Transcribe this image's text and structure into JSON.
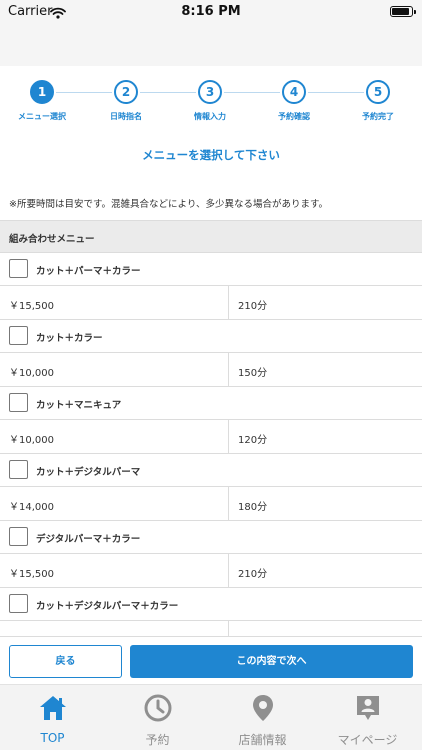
{
  "status_bar": {
    "carrier": "Carrier",
    "time": "8:16 PM"
  },
  "steps": [
    {
      "number": "1",
      "label": "メニュー選択",
      "active": true
    },
    {
      "number": "2",
      "label": "日時指名",
      "active": false
    },
    {
      "number": "3",
      "label": "情報入力",
      "active": false
    },
    {
      "number": "4",
      "label": "予約確認",
      "active": false
    },
    {
      "number": "5",
      "label": "予約完了",
      "active": false
    }
  ],
  "heading": "メニューを選択して下さい",
  "notice": "※所要時間は目安です。混雑具合などにより、多少異なる場合があります。",
  "section": {
    "title": "組み合わせメニュー"
  },
  "menu_items": [
    {
      "name": "カット＋パーマ＋カラー",
      "price": "￥15,500",
      "duration": "210分"
    },
    {
      "name": "カット＋カラー",
      "price": "￥10,000",
      "duration": "150分"
    },
    {
      "name": "カット＋マニキュア",
      "price": "￥10,000",
      "duration": "120分"
    },
    {
      "name": "カット＋デジタルパーマ",
      "price": "￥14,000",
      "duration": "180分"
    },
    {
      "name": "デジタルパーマ＋カラー",
      "price": "￥15,500",
      "duration": "210分"
    },
    {
      "name": "カット＋デジタルパーマ＋カラー",
      "price": "",
      "duration": ""
    }
  ],
  "buttons": {
    "back": "戻る",
    "next": "この内容で次へ"
  },
  "tab_bar": {
    "tabs": [
      {
        "label": "TOP",
        "icon": "home-icon",
        "active": true
      },
      {
        "label": "予約",
        "icon": "clock-icon",
        "active": false
      },
      {
        "label": "店舗情報",
        "icon": "location-pin-icon",
        "active": false
      },
      {
        "label": "マイページ",
        "icon": "user-badge-icon",
        "active": false
      }
    ]
  },
  "colors": {
    "accent": "#1f86d1",
    "inactive_tab": "#8f8f8f",
    "section_bg": "#ebebeb"
  }
}
